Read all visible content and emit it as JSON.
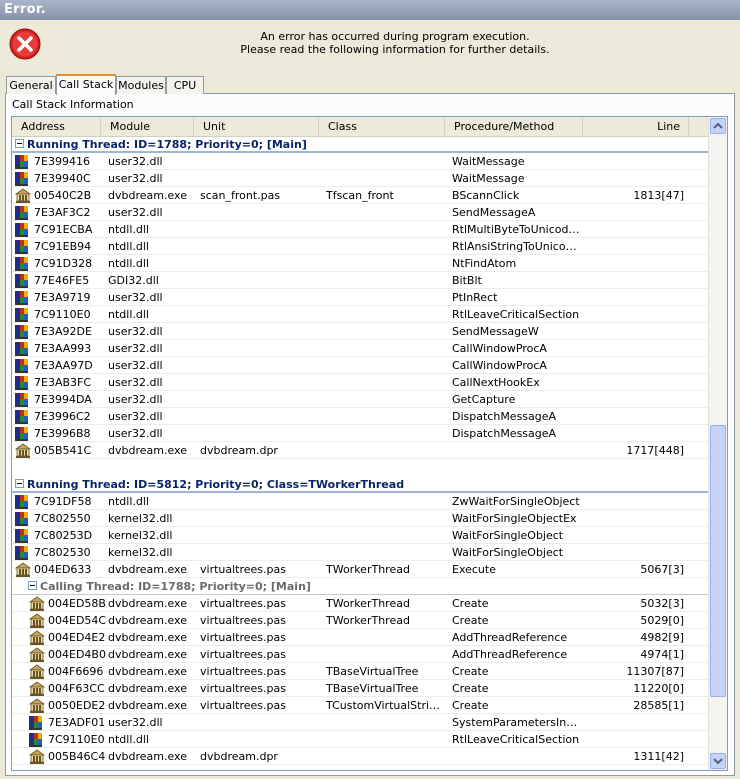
{
  "window": {
    "title": "Error."
  },
  "message": {
    "line1": "An error has occurred during program execution.",
    "line2": "Please read the following information for further details."
  },
  "tabs": [
    "General",
    "Call Stack",
    "Modules",
    "CPU"
  ],
  "active_tab": "Call Stack",
  "section_label": "Call Stack Information",
  "columns": [
    "Address",
    "Module",
    "Unit",
    "Class",
    "Procedure/Method",
    "Line"
  ],
  "rows": [
    {
      "kind": "thread",
      "text": "Running Thread: ID=1788; Priority=0; [Main]"
    },
    {
      "icon": "sys",
      "address": "7E399416",
      "module": "user32.dll",
      "unit": "",
      "class": "",
      "proc": "WaitMessage",
      "line": ""
    },
    {
      "icon": "sys",
      "address": "7E39940C",
      "module": "user32.dll",
      "unit": "",
      "class": "",
      "proc": "WaitMessage",
      "line": ""
    },
    {
      "icon": "app",
      "address": "00540C2B",
      "module": "dvbdream.exe",
      "unit": "scan_front.pas",
      "class": "Tfscan_front",
      "proc": "BScannClick",
      "line": "1813[47]"
    },
    {
      "icon": "sys",
      "address": "7E3AF3C2",
      "module": "user32.dll",
      "unit": "",
      "class": "",
      "proc": "SendMessageA",
      "line": ""
    },
    {
      "icon": "sys",
      "address": "7C91ECBA",
      "module": "ntdll.dll",
      "unit": "",
      "class": "",
      "proc": "RtlMultiByteToUnicodeN",
      "line": ""
    },
    {
      "icon": "sys",
      "address": "7C91EB94",
      "module": "ntdll.dll",
      "unit": "",
      "class": "",
      "proc": "RtlAnsiStringToUnicode…",
      "line": ""
    },
    {
      "icon": "sys",
      "address": "7C91D328",
      "module": "ntdll.dll",
      "unit": "",
      "class": "",
      "proc": "NtFindAtom",
      "line": ""
    },
    {
      "icon": "sys",
      "address": "77E46FE5",
      "module": "GDI32.dll",
      "unit": "",
      "class": "",
      "proc": "BitBlt",
      "line": ""
    },
    {
      "icon": "sys",
      "address": "7E3A9719",
      "module": "user32.dll",
      "unit": "",
      "class": "",
      "proc": "PtInRect",
      "line": ""
    },
    {
      "icon": "sys",
      "address": "7C9110E0",
      "module": "ntdll.dll",
      "unit": "",
      "class": "",
      "proc": "RtlLeaveCriticalSection",
      "line": ""
    },
    {
      "icon": "sys",
      "address": "7E3A92DE",
      "module": "user32.dll",
      "unit": "",
      "class": "",
      "proc": "SendMessageW",
      "line": ""
    },
    {
      "icon": "sys",
      "address": "7E3AA993",
      "module": "user32.dll",
      "unit": "",
      "class": "",
      "proc": "CallWindowProcA",
      "line": ""
    },
    {
      "icon": "sys",
      "address": "7E3AA97D",
      "module": "user32.dll",
      "unit": "",
      "class": "",
      "proc": "CallWindowProcA",
      "line": ""
    },
    {
      "icon": "sys",
      "address": "7E3AB3FC",
      "module": "user32.dll",
      "unit": "",
      "class": "",
      "proc": "CallNextHookEx",
      "line": ""
    },
    {
      "icon": "sys",
      "address": "7E3994DA",
      "module": "user32.dll",
      "unit": "",
      "class": "",
      "proc": "GetCapture",
      "line": ""
    },
    {
      "icon": "sys",
      "address": "7E3996C2",
      "module": "user32.dll",
      "unit": "",
      "class": "",
      "proc": "DispatchMessageA",
      "line": ""
    },
    {
      "icon": "sys",
      "address": "7E3996B8",
      "module": "user32.dll",
      "unit": "",
      "class": "",
      "proc": "DispatchMessageA",
      "line": ""
    },
    {
      "icon": "app",
      "address": "005B541C",
      "module": "dvbdream.exe",
      "unit": "dvbdream.dpr",
      "class": "",
      "proc": "",
      "line": "1717[448]"
    },
    {
      "kind": "blank"
    },
    {
      "kind": "thread",
      "text": "Running Thread: ID=5812; Priority=0; Class=TWorkerThread"
    },
    {
      "icon": "sys",
      "address": "7C91DF58",
      "module": "ntdll.dll",
      "unit": "",
      "class": "",
      "proc": "ZwWaitForSingleObject",
      "line": ""
    },
    {
      "icon": "sys",
      "address": "7C802550",
      "module": "kernel32.dll",
      "unit": "",
      "class": "",
      "proc": "WaitForSingleObjectEx",
      "line": ""
    },
    {
      "icon": "sys",
      "address": "7C80253D",
      "module": "kernel32.dll",
      "unit": "",
      "class": "",
      "proc": "WaitForSingleObject",
      "line": ""
    },
    {
      "icon": "sys",
      "address": "7C802530",
      "module": "kernel32.dll",
      "unit": "",
      "class": "",
      "proc": "WaitForSingleObject",
      "line": ""
    },
    {
      "icon": "app",
      "address": "004ED633",
      "module": "dvbdream.exe",
      "unit": "virtualtrees.pas",
      "class": "TWorkerThread",
      "proc": "Execute",
      "line": "5067[3]"
    },
    {
      "kind": "calling",
      "text": "Calling Thread: ID=1788; Priority=0; [Main]"
    },
    {
      "icon": "app",
      "indent": true,
      "address": "004ED58B",
      "module": "dvbdream.exe",
      "unit": "virtualtrees.pas",
      "class": "TWorkerThread",
      "proc": "Create",
      "line": "5032[3]"
    },
    {
      "icon": "app",
      "indent": true,
      "address": "004ED54C",
      "module": "dvbdream.exe",
      "unit": "virtualtrees.pas",
      "class": "TWorkerThread",
      "proc": "Create",
      "line": "5029[0]"
    },
    {
      "icon": "app",
      "indent": true,
      "address": "004ED4E2",
      "module": "dvbdream.exe",
      "unit": "virtualtrees.pas",
      "class": "",
      "proc": "AddThreadReference",
      "line": "4982[9]"
    },
    {
      "icon": "app",
      "indent": true,
      "address": "004ED4B0",
      "module": "dvbdream.exe",
      "unit": "virtualtrees.pas",
      "class": "",
      "proc": "AddThreadReference",
      "line": "4974[1]"
    },
    {
      "icon": "app",
      "indent": true,
      "address": "004F6696",
      "module": "dvbdream.exe",
      "unit": "virtualtrees.pas",
      "class": "TBaseVirtualTree",
      "proc": "Create",
      "line": "11307[87]"
    },
    {
      "icon": "app",
      "indent": true,
      "address": "004F63CC",
      "module": "dvbdream.exe",
      "unit": "virtualtrees.pas",
      "class": "TBaseVirtualTree",
      "proc": "Create",
      "line": "11220[0]"
    },
    {
      "icon": "app",
      "indent": true,
      "address": "0050EDE2",
      "module": "dvbdream.exe",
      "unit": "virtualtrees.pas",
      "class": "TCustomVirtualString…",
      "proc": "Create",
      "line": "28585[1]"
    },
    {
      "icon": "sys",
      "indent": true,
      "address": "7E3ADF01",
      "module": "user32.dll",
      "unit": "",
      "class": "",
      "proc": "SystemParametersInfoA",
      "line": ""
    },
    {
      "icon": "sys",
      "indent": true,
      "address": "7C9110E0",
      "module": "ntdll.dll",
      "unit": "",
      "class": "",
      "proc": "RtlLeaveCriticalSection",
      "line": ""
    },
    {
      "icon": "app",
      "indent": true,
      "address": "005B46C4",
      "module": "dvbdream.exe",
      "unit": "dvbdream.dpr",
      "class": "",
      "proc": "",
      "line": "1311[42]"
    }
  ],
  "scrollbar": {
    "position_fraction": 0.47,
    "visible_fraction": 0.44
  }
}
